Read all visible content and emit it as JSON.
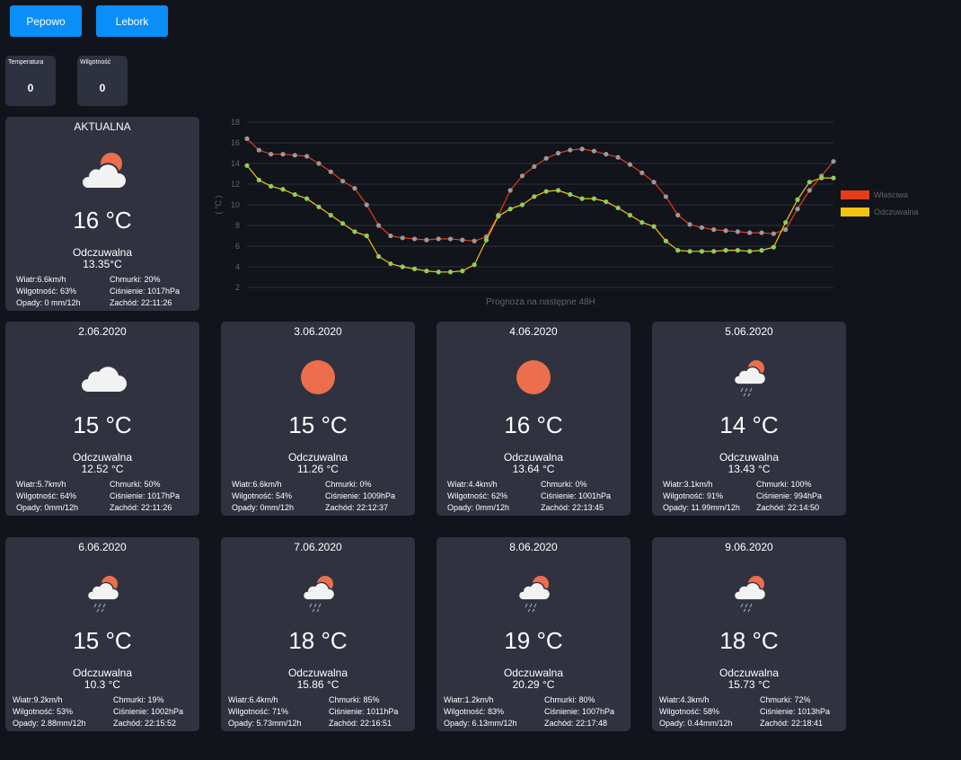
{
  "locations": [
    "Pepowo",
    "Lebork"
  ],
  "stats": [
    {
      "label": "Temperatura",
      "value": "0"
    },
    {
      "label": "Wilgotność",
      "value": "0"
    }
  ],
  "cards": [
    {
      "title": "AKTUALNA",
      "icon": "cloud-sun-icon",
      "temp": "16 °C",
      "feels_label": "Odczuwalna",
      "feels": "13.35°C",
      "wind": "Wiatr:6.6km/h",
      "clouds": "Chmurki: 20%",
      "humidity": "Wilgotność: 63%",
      "pressure": "Ciśnienie: 1017hPa",
      "rain": "Opady: 0 mm/12h",
      "sunset": "Zachód: 22:11:26"
    },
    {
      "title": "2.06.2020",
      "icon": "cloud-icon",
      "temp": "15 °C",
      "feels_label": "Odczuwalna",
      "feels": "12.52 °C",
      "wind": "Wiatr:5.7km/h",
      "clouds": "Chmurki: 50%",
      "humidity": "Wilgotność: 64%",
      "pressure": "Ciśnienie: 1017hPa",
      "rain": "Opady: 0mm/12h",
      "sunset": "Zachód: 22:11:26"
    },
    {
      "title": "3.06.2020",
      "icon": "sun-icon",
      "temp": "15 °C",
      "feels_label": "Odczuwalna",
      "feels": "11.26 °C",
      "wind": "Wiatr:6.6km/h",
      "clouds": "Chmurki: 0%",
      "humidity": "Wilgotność: 54%",
      "pressure": "Ciśnienie: 1009hPa",
      "rain": "Opady: 0mm/12h",
      "sunset": "Zachód: 22:12:37"
    },
    {
      "title": "4.06.2020",
      "icon": "sun-icon",
      "temp": "16 °C",
      "feels_label": "Odczuwalna",
      "feels": "13.64 °C",
      "wind": "Wiatr:4.4km/h",
      "clouds": "Chmurki: 0%",
      "humidity": "Wilgotność: 62%",
      "pressure": "Ciśnienie: 1001hPa",
      "rain": "Opady: 0mm/12h",
      "sunset": "Zachód: 22:13:45"
    },
    {
      "title": "5.06.2020",
      "icon": "cloud-sun-rain-icon",
      "temp": "14 °C",
      "feels_label": "Odczuwalna",
      "feels": "13.43 °C",
      "wind": "Wiatr:3.1km/h",
      "clouds": "Chmurki: 100%",
      "humidity": "Wilgotność: 91%",
      "pressure": "Ciśnienie: 994hPa",
      "rain": "Opady: 11.99mm/12h",
      "sunset": "Zachód: 22:14:50"
    },
    {
      "title": "6.06.2020",
      "icon": "cloud-sun-rain-icon",
      "temp": "15 °C",
      "feels_label": "Odczuwalna",
      "feels": "10.3 °C",
      "wind": "Wiatr:9.2km/h",
      "clouds": "Chmurki: 19%",
      "humidity": "Wilgotność: 53%",
      "pressure": "Ciśnienie: 1002hPa",
      "rain": "Opady: 2.88mm/12h",
      "sunset": "Zachód: 22:15:52"
    },
    {
      "title": "7.06.2020",
      "icon": "cloud-sun-rain-icon",
      "temp": "18 °C",
      "feels_label": "Odczuwalna",
      "feels": "15.86 °C",
      "wind": "Wiatr:6.4km/h",
      "clouds": "Chmurki: 85%",
      "humidity": "Wilgotność: 71%",
      "pressure": "Ciśnienie: 1011hPa",
      "rain": "Opady: 5.73mm/12h",
      "sunset": "Zachód: 22:16:51"
    },
    {
      "title": "8.06.2020",
      "icon": "cloud-sun-rain-icon",
      "temp": "19 °C",
      "feels_label": "Odczuwalna",
      "feels": "20.29 °C",
      "wind": "Wiatr:1.2km/h",
      "clouds": "Chmurki: 80%",
      "humidity": "Wilgotność: 83%",
      "pressure": "Ciśnienie: 1007hPa",
      "rain": "Opady: 6.13mm/12h",
      "sunset": "Zachód: 22:17:48"
    },
    {
      "title": "9.06.2020",
      "icon": "cloud-sun-rain-icon",
      "temp": "18 °C",
      "feels_label": "Odczuwalna",
      "feels": "15.73 °C",
      "wind": "Wiatr:4.3km/h",
      "clouds": "Chmurki: 72%",
      "humidity": "Wilgotność: 58%",
      "pressure": "Ciśnienie: 1013hPa",
      "rain": "Opady: 0.44mm/12h",
      "sunset": "Zachód: 22:18:41"
    }
  ],
  "colors": {
    "button": "#0a8ef8",
    "card": "#303240",
    "background": "#12141b",
    "sun": "#ec6e4c",
    "cloud": "#f2f2f2",
    "actual": "#e43d15",
    "feels": "#f4c40f"
  },
  "chart_data": {
    "type": "line",
    "title": "",
    "xlabel": "Prognoza na następne 48H",
    "ylabel": "( °C )",
    "ylim": [
      2,
      18
    ],
    "yticks": [
      "2",
      "4",
      "6",
      "8",
      "10",
      "12",
      "14",
      "16",
      "18"
    ],
    "grid": true,
    "legend": "right",
    "series": [
      {
        "name": "Właściwa",
        "color": "#e43d15",
        "values": [
          16.4,
          15.3,
          14.9,
          14.9,
          14.8,
          14.7,
          14.0,
          13.2,
          12.3,
          11.6,
          10.0,
          8.0,
          7.0,
          6.8,
          6.7,
          6.6,
          6.7,
          6.7,
          6.6,
          6.5,
          6.9,
          9.0,
          11.4,
          12.8,
          13.7,
          14.5,
          15.0,
          15.3,
          15.4,
          15.2,
          14.9,
          14.6,
          13.9,
          13.1,
          12.2,
          10.8,
          9.0,
          8.1,
          7.8,
          7.6,
          7.5,
          7.4,
          7.3,
          7.3,
          7.2,
          7.6,
          9.6,
          11.4,
          12.8,
          14.2
        ]
      },
      {
        "name": "Odczuwalna",
        "color": "#f4c40f",
        "values": [
          13.8,
          12.4,
          11.8,
          11.5,
          11.0,
          10.6,
          9.8,
          9.0,
          8.2,
          7.4,
          7.0,
          5.0,
          4.3,
          4.0,
          3.8,
          3.6,
          3.5,
          3.5,
          3.6,
          4.2,
          6.6,
          8.9,
          9.6,
          10.0,
          10.8,
          11.3,
          11.4,
          11.0,
          10.6,
          10.6,
          10.3,
          9.7,
          9.0,
          8.3,
          7.9,
          6.5,
          5.6,
          5.5,
          5.5,
          5.5,
          5.6,
          5.6,
          5.5,
          5.6,
          5.9,
          8.3,
          10.5,
          12.2,
          12.6,
          12.6
        ]
      }
    ]
  }
}
